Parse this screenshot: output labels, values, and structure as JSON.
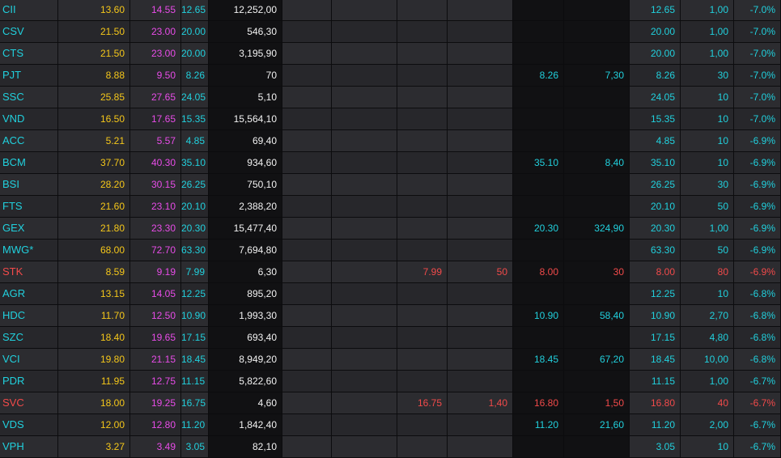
{
  "colors": {
    "ceiling": "#e84ce8",
    "reference": "#f5c71a",
    "floor": "#21d0dd",
    "down": "#f24a4a",
    "volume": "#f2f2f2"
  },
  "rows": [
    {
      "symbol": "CII",
      "ref": "13.60",
      "ceil": "14.55",
      "floor": "12.65",
      "total_volume": "12,252,00",
      "bid_p1": "",
      "bid_v1": "",
      "ask_p1": "",
      "ask_v1": "",
      "match_price": "12.65",
      "match_volume": "1,00",
      "change": "-7.0%",
      "state": "floor"
    },
    {
      "symbol": "CSV",
      "ref": "21.50",
      "ceil": "23.00",
      "floor": "20.00",
      "total_volume": "546,30",
      "bid_p1": "",
      "bid_v1": "",
      "ask_p1": "",
      "ask_v1": "",
      "match_price": "20.00",
      "match_volume": "1,00",
      "change": "-7.0%",
      "state": "floor"
    },
    {
      "symbol": "CTS",
      "ref": "21.50",
      "ceil": "23.00",
      "floor": "20.00",
      "total_volume": "3,195,90",
      "bid_p1": "",
      "bid_v1": "",
      "ask_p1": "",
      "ask_v1": "",
      "match_price": "20.00",
      "match_volume": "1,00",
      "change": "-7.0%",
      "state": "floor"
    },
    {
      "symbol": "PJT",
      "ref": "8.88",
      "ceil": "9.50",
      "floor": "8.26",
      "total_volume": "70",
      "bid_p1": "",
      "bid_v1": "",
      "ask_p1": "8.26",
      "ask_v1": "7,30",
      "match_price": "8.26",
      "match_volume": "30",
      "change": "-7.0%",
      "state": "floor"
    },
    {
      "symbol": "SSC",
      "ref": "25.85",
      "ceil": "27.65",
      "floor": "24.05",
      "total_volume": "5,10",
      "bid_p1": "",
      "bid_v1": "",
      "ask_p1": "",
      "ask_v1": "",
      "match_price": "24.05",
      "match_volume": "10",
      "change": "-7.0%",
      "state": "floor"
    },
    {
      "symbol": "VND",
      "ref": "16.50",
      "ceil": "17.65",
      "floor": "15.35",
      "total_volume": "15,564,10",
      "bid_p1": "",
      "bid_v1": "",
      "ask_p1": "",
      "ask_v1": "",
      "match_price": "15.35",
      "match_volume": "10",
      "change": "-7.0%",
      "state": "floor"
    },
    {
      "symbol": "ACC",
      "ref": "5.21",
      "ceil": "5.57",
      "floor": "4.85",
      "total_volume": "69,40",
      "bid_p1": "",
      "bid_v1": "",
      "ask_p1": "",
      "ask_v1": "",
      "match_price": "4.85",
      "match_volume": "10",
      "change": "-6.9%",
      "state": "floor"
    },
    {
      "symbol": "BCM",
      "ref": "37.70",
      "ceil": "40.30",
      "floor": "35.10",
      "total_volume": "934,60",
      "bid_p1": "",
      "bid_v1": "",
      "ask_p1": "35.10",
      "ask_v1": "8,40",
      "match_price": "35.10",
      "match_volume": "10",
      "change": "-6.9%",
      "state": "floor"
    },
    {
      "symbol": "BSI",
      "ref": "28.20",
      "ceil": "30.15",
      "floor": "26.25",
      "total_volume": "750,10",
      "bid_p1": "",
      "bid_v1": "",
      "ask_p1": "",
      "ask_v1": "",
      "match_price": "26.25",
      "match_volume": "30",
      "change": "-6.9%",
      "state": "floor"
    },
    {
      "symbol": "FTS",
      "ref": "21.60",
      "ceil": "23.10",
      "floor": "20.10",
      "total_volume": "2,388,20",
      "bid_p1": "",
      "bid_v1": "",
      "ask_p1": "",
      "ask_v1": "",
      "match_price": "20.10",
      "match_volume": "50",
      "change": "-6.9%",
      "state": "floor"
    },
    {
      "symbol": "GEX",
      "ref": "21.80",
      "ceil": "23.30",
      "floor": "20.30",
      "total_volume": "15,477,40",
      "bid_p1": "",
      "bid_v1": "",
      "ask_p1": "20.30",
      "ask_v1": "324,90",
      "match_price": "20.30",
      "match_volume": "1,00",
      "change": "-6.9%",
      "state": "floor"
    },
    {
      "symbol": "MWG*",
      "ref": "68.00",
      "ceil": "72.70",
      "floor": "63.30",
      "total_volume": "7,694,80",
      "bid_p1": "",
      "bid_v1": "",
      "ask_p1": "",
      "ask_v1": "",
      "match_price": "63.30",
      "match_volume": "50",
      "change": "-6.9%",
      "state": "floor"
    },
    {
      "symbol": "STK",
      "ref": "8.59",
      "ceil": "9.19",
      "floor": "7.99",
      "total_volume": "6,30",
      "bid_p1": "7.99",
      "bid_v1": "50",
      "ask_p1": "8.00",
      "ask_v1": "30",
      "match_price": "8.00",
      "match_volume": "80",
      "change": "-6.9%",
      "state": "down"
    },
    {
      "symbol": "AGR",
      "ref": "13.15",
      "ceil": "14.05",
      "floor": "12.25",
      "total_volume": "895,20",
      "bid_p1": "",
      "bid_v1": "",
      "ask_p1": "",
      "ask_v1": "",
      "match_price": "12.25",
      "match_volume": "10",
      "change": "-6.8%",
      "state": "floor"
    },
    {
      "symbol": "HDC",
      "ref": "11.70",
      "ceil": "12.50",
      "floor": "10.90",
      "total_volume": "1,993,30",
      "bid_p1": "",
      "bid_v1": "",
      "ask_p1": "10.90",
      "ask_v1": "58,40",
      "match_price": "10.90",
      "match_volume": "2,70",
      "change": "-6.8%",
      "state": "floor"
    },
    {
      "symbol": "SZC",
      "ref": "18.40",
      "ceil": "19.65",
      "floor": "17.15",
      "total_volume": "693,40",
      "bid_p1": "",
      "bid_v1": "",
      "ask_p1": "",
      "ask_v1": "",
      "match_price": "17.15",
      "match_volume": "4,80",
      "change": "-6.8%",
      "state": "floor"
    },
    {
      "symbol": "VCI",
      "ref": "19.80",
      "ceil": "21.15",
      "floor": "18.45",
      "total_volume": "8,949,20",
      "bid_p1": "",
      "bid_v1": "",
      "ask_p1": "18.45",
      "ask_v1": "67,20",
      "match_price": "18.45",
      "match_volume": "10,00",
      "change": "-6.8%",
      "state": "floor"
    },
    {
      "symbol": "PDR",
      "ref": "11.95",
      "ceil": "12.75",
      "floor": "11.15",
      "total_volume": "5,822,60",
      "bid_p1": "",
      "bid_v1": "",
      "ask_p1": "",
      "ask_v1": "",
      "match_price": "11.15",
      "match_volume": "1,00",
      "change": "-6.7%",
      "state": "floor"
    },
    {
      "symbol": "SVC",
      "ref": "18.00",
      "ceil": "19.25",
      "floor": "16.75",
      "total_volume": "4,60",
      "bid_p1": "16.75",
      "bid_v1": "1,40",
      "ask_p1": "16.80",
      "ask_v1": "1,50",
      "match_price": "16.80",
      "match_volume": "40",
      "change": "-6.7%",
      "state": "down"
    },
    {
      "symbol": "VDS",
      "ref": "12.00",
      "ceil": "12.80",
      "floor": "11.20",
      "total_volume": "1,842,40",
      "bid_p1": "",
      "bid_v1": "",
      "ask_p1": "11.20",
      "ask_v1": "21,60",
      "match_price": "11.20",
      "match_volume": "2,00",
      "change": "-6.7%",
      "state": "floor"
    },
    {
      "symbol": "VPH",
      "ref": "3.27",
      "ceil": "3.49",
      "floor": "3.05",
      "total_volume": "82,10",
      "bid_p1": "",
      "bid_v1": "",
      "ask_p1": "",
      "ask_v1": "",
      "match_price": "3.05",
      "match_volume": "10",
      "change": "-6.7%",
      "state": "floor"
    }
  ]
}
